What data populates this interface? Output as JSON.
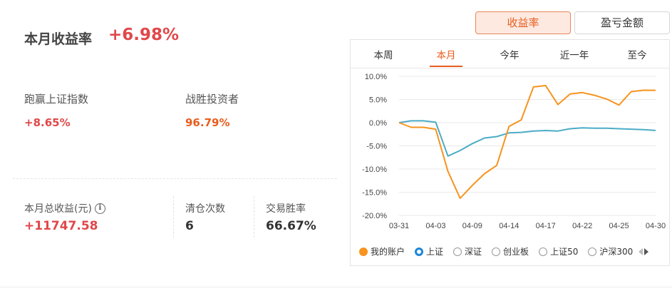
{
  "summary": {
    "month_title": "本月收益率",
    "month_value": "+6.98%",
    "beat_index_label": "跑赢上证指数",
    "beat_index_value": "+8.65%",
    "beat_investors_label": "战胜投资者",
    "beat_investors_value": "96.79%",
    "total_income_label": "本月总收益(元)",
    "total_income_value": "+11747.58",
    "clear_count_label": "清仓次数",
    "clear_count_value": "6",
    "win_rate_label": "交易胜率",
    "win_rate_value": "66.67%"
  },
  "toggles": {
    "yield_label": "收益率",
    "amount_label": "盈亏金额"
  },
  "tabs": [
    "本周",
    "本月",
    "今年",
    "近一年",
    "至今"
  ],
  "legend": [
    "我的账户",
    "上证",
    "深证",
    "创业板",
    "上证50",
    "沪深300"
  ],
  "colors": {
    "account": "#f7931e",
    "index": "#4bacc6",
    "accent": "#e85d1e",
    "red": "#e0484a"
  },
  "chart_data": {
    "type": "line",
    "y_ticks": [
      "10.0%",
      "5.0%",
      "0.0%",
      "-5.0%",
      "-10.0%",
      "-15.0%",
      "-20.0%"
    ],
    "x_ticks": [
      "03-31",
      "04-03",
      "04-09",
      "04-14",
      "04-17",
      "04-22",
      "04-25",
      "04-30"
    ],
    "ylim": [
      -20,
      10
    ],
    "x": [
      "03-31",
      "04-01",
      "04-02",
      "04-03",
      "04-07",
      "04-08",
      "04-09",
      "04-10",
      "04-11",
      "04-14",
      "04-15",
      "04-16",
      "04-17",
      "04-18",
      "04-21",
      "04-22",
      "04-23",
      "04-24",
      "04-25",
      "04-28",
      "04-29",
      "04-30"
    ],
    "series": [
      {
        "name": "我的账户",
        "values": [
          0.0,
          -1.0,
          -1.0,
          -1.4,
          -10.5,
          -16.3,
          -13.5,
          -11.0,
          -9.2,
          -0.8,
          0.6,
          7.7,
          8.0,
          3.9,
          6.2,
          6.5,
          5.9,
          5.1,
          3.8,
          6.7,
          7.0,
          6.98
        ]
      },
      {
        "name": "上证",
        "values": [
          0.0,
          0.4,
          0.4,
          0.1,
          -7.2,
          -6.0,
          -4.5,
          -3.3,
          -3.0,
          -2.2,
          -2.1,
          -1.8,
          -1.7,
          -1.8,
          -1.3,
          -1.1,
          -1.2,
          -1.2,
          -1.3,
          -1.4,
          -1.5,
          -1.67
        ]
      }
    ]
  }
}
